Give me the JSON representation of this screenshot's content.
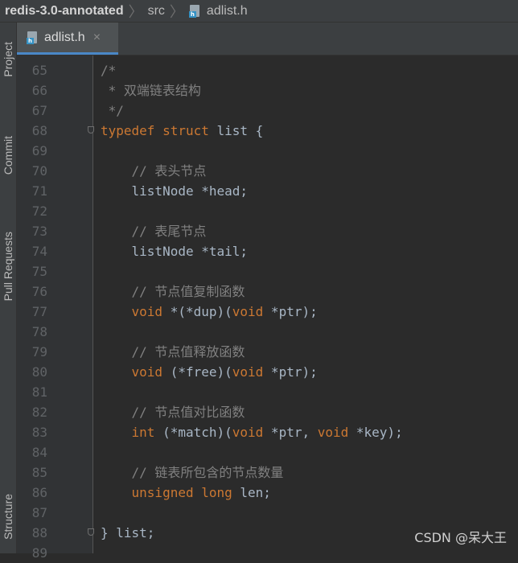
{
  "breadcrumb": {
    "project": "redis-3.0-annotated",
    "folder": "src",
    "file": "adlist.h",
    "file_icon": "c-header-file-icon"
  },
  "sidebar": {
    "tabs": [
      {
        "label": "Project",
        "icon": "folder-icon"
      },
      {
        "label": "Commit",
        "icon": "commit-icon"
      },
      {
        "label": "Pull Requests",
        "icon": "pull-request-icon"
      },
      {
        "label": "Structure",
        "icon": "structure-icon"
      }
    ]
  },
  "editor_tab": {
    "label": "adlist.h",
    "close": "×"
  },
  "code_lines": [
    {
      "n": "65",
      "tokens": [
        {
          "t": "/*",
          "c": "c"
        }
      ]
    },
    {
      "n": "66",
      "tokens": [
        {
          "t": " * 双端链表结构",
          "c": "c"
        }
      ]
    },
    {
      "n": "67",
      "tokens": [
        {
          "t": " */",
          "c": "c"
        }
      ]
    },
    {
      "n": "68",
      "fold": true,
      "tokens": [
        {
          "t": "typedef",
          "c": "k"
        },
        {
          "t": " "
        },
        {
          "t": "struct",
          "c": "k"
        },
        {
          "t": " list {"
        }
      ]
    },
    {
      "n": "69",
      "tokens": []
    },
    {
      "n": "70",
      "tokens": [
        {
          "t": "    // 表头节点",
          "c": "c"
        }
      ]
    },
    {
      "n": "71",
      "tokens": [
        {
          "t": "    listNode *head;"
        }
      ]
    },
    {
      "n": "72",
      "tokens": []
    },
    {
      "n": "73",
      "tokens": [
        {
          "t": "    // 表尾节点",
          "c": "c"
        }
      ]
    },
    {
      "n": "74",
      "tokens": [
        {
          "t": "    listNode *tail;"
        }
      ]
    },
    {
      "n": "75",
      "tokens": []
    },
    {
      "n": "76",
      "tokens": [
        {
          "t": "    // 节点值复制函数",
          "c": "c"
        }
      ]
    },
    {
      "n": "77",
      "tokens": [
        {
          "t": "    "
        },
        {
          "t": "void",
          "c": "k"
        },
        {
          "t": " *(*dup)("
        },
        {
          "t": "void",
          "c": "k"
        },
        {
          "t": " *ptr);"
        }
      ]
    },
    {
      "n": "78",
      "tokens": []
    },
    {
      "n": "79",
      "tokens": [
        {
          "t": "    // 节点值释放函数",
          "c": "c"
        }
      ]
    },
    {
      "n": "80",
      "tokens": [
        {
          "t": "    "
        },
        {
          "t": "void",
          "c": "k"
        },
        {
          "t": " (*free)("
        },
        {
          "t": "void",
          "c": "k"
        },
        {
          "t": " *ptr);"
        }
      ]
    },
    {
      "n": "81",
      "tokens": []
    },
    {
      "n": "82",
      "tokens": [
        {
          "t": "    // 节点值对比函数",
          "c": "c"
        }
      ]
    },
    {
      "n": "83",
      "tokens": [
        {
          "t": "    "
        },
        {
          "t": "int",
          "c": "k"
        },
        {
          "t": " (*match)("
        },
        {
          "t": "void",
          "c": "k"
        },
        {
          "t": " *ptr, "
        },
        {
          "t": "void",
          "c": "k"
        },
        {
          "t": " *key);"
        }
      ]
    },
    {
      "n": "84",
      "tokens": []
    },
    {
      "n": "85",
      "tokens": [
        {
          "t": "    // 链表所包含的节点数量",
          "c": "c"
        }
      ]
    },
    {
      "n": "86",
      "tokens": [
        {
          "t": "    "
        },
        {
          "t": "unsigned",
          "c": "k"
        },
        {
          "t": " "
        },
        {
          "t": "long",
          "c": "k"
        },
        {
          "t": " len;"
        }
      ]
    },
    {
      "n": "87",
      "tokens": []
    },
    {
      "n": "88",
      "fold": true,
      "tokens": [
        {
          "t": "} list;"
        }
      ]
    },
    {
      "n": "89",
      "tokens": []
    }
  ],
  "watermark": "CSDN @呆大王",
  "colors": {
    "background": "#2b2b2b",
    "keyword": "#cc7832",
    "comment": "#808080",
    "identifier": "#a9b7c6",
    "line_number": "#606366",
    "accent": "#4a88c7"
  }
}
